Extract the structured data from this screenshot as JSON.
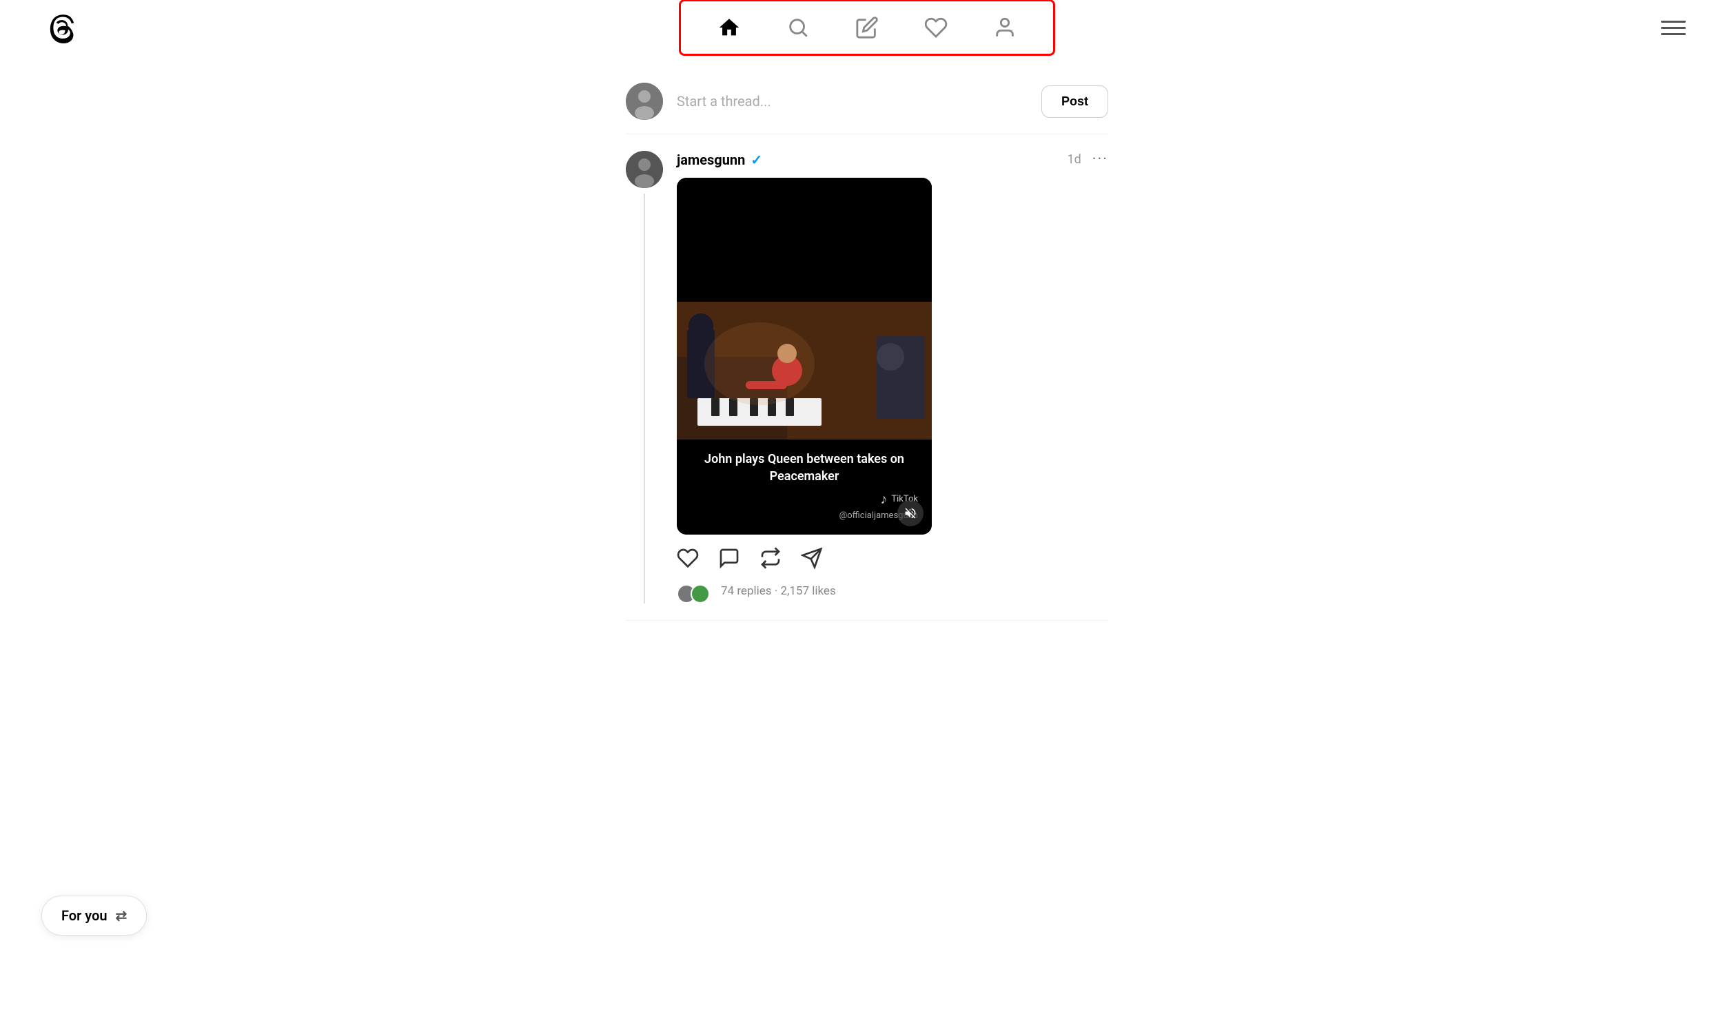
{
  "logo": {
    "alt": "Threads logo"
  },
  "topNav": {
    "home_icon": "home",
    "search_icon": "search",
    "compose_icon": "compose",
    "activity_icon": "heart",
    "profile_icon": "person",
    "menu_icon": "menu"
  },
  "composer": {
    "placeholder": "Start a thread...",
    "post_label": "Post"
  },
  "post": {
    "author": "jamesgunn",
    "verified": true,
    "timestamp": "1d",
    "video_caption": "John plays Queen between takes on Peacemaker",
    "tiktok_label": "TikTok",
    "tiktok_user": "@officialjamesgunn",
    "replies_count": "74 replies",
    "likes_count": "2,157 likes",
    "stats_separator": "·"
  },
  "forYou": {
    "label": "For you",
    "icon": "⇄"
  }
}
